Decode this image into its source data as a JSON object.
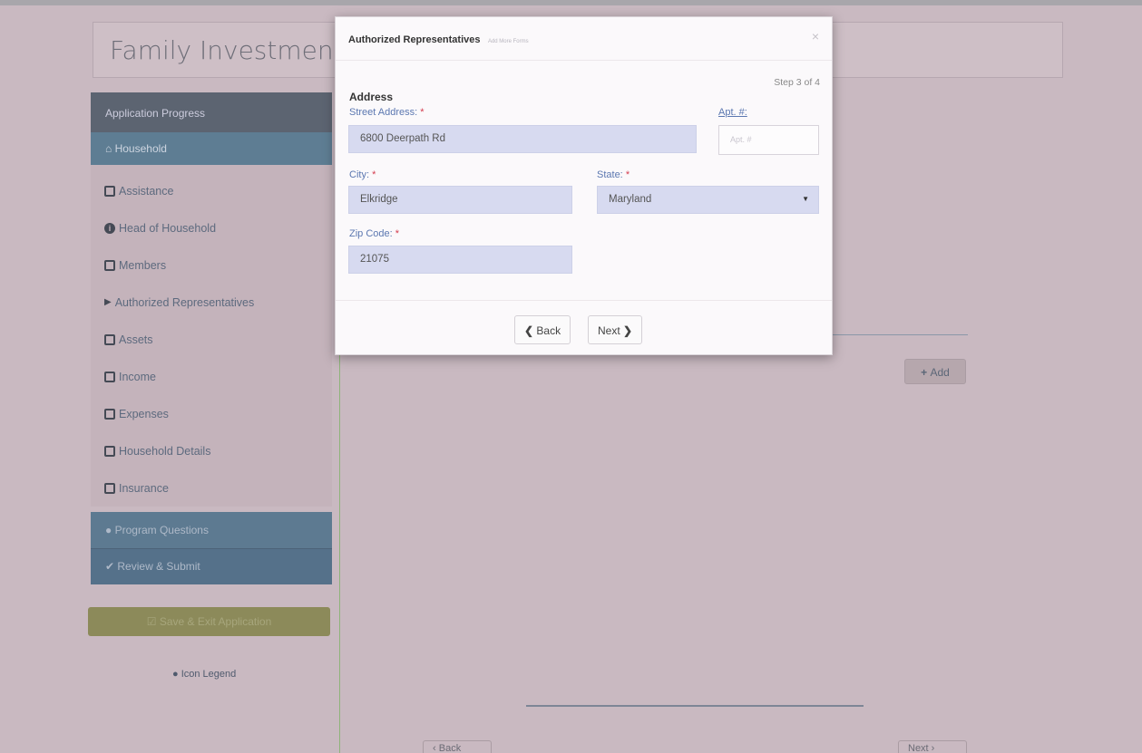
{
  "page": {
    "title": "Family Investment"
  },
  "sidebar": {
    "header": "Application Progress",
    "household": "Household",
    "items": [
      {
        "label": "Assistance",
        "icon": "checked-box-icon"
      },
      {
        "label": "Head of Household",
        "icon": "info-circle-icon"
      },
      {
        "label": "Members",
        "icon": "checked-box-icon"
      },
      {
        "label": "Authorized Representatives",
        "icon": "play-icon"
      },
      {
        "label": "Assets",
        "icon": "empty-box-icon"
      },
      {
        "label": "Income",
        "icon": "empty-box-icon"
      },
      {
        "label": "Expenses",
        "icon": "empty-box-icon"
      },
      {
        "label": "Household Details",
        "icon": "empty-box-icon"
      },
      {
        "label": "Insurance",
        "icon": "empty-box-icon"
      }
    ],
    "program_questions": "Program Questions",
    "review_submit": "Review & Submit",
    "save_exit": "Save & Exit Application",
    "icon_legend": "Icon Legend"
  },
  "content": {
    "add_label": "Add",
    "back_label": "Back",
    "next_label": "Next"
  },
  "modal": {
    "title": "Authorized Representatives",
    "subtitle": "Add More Forms",
    "close": "×",
    "step": "Step 3 of 4",
    "section": "Address",
    "street_label": "Street Address:",
    "street_value": "6800 Deerpath Rd",
    "apt_label": "Apt. #:",
    "apt_placeholder": "Apt. #",
    "city_label": "City:",
    "city_value": "Elkridge",
    "state_label": "State:",
    "state_value": "Maryland",
    "zip_label": "Zip Code:",
    "zip_value": "21075",
    "required_mark": "*",
    "back_label": "Back",
    "next_label": "Next"
  },
  "colors": {
    "overlay": "#c9b9c1",
    "sidebar_active": "#5e7d93",
    "field_fill": "#d7daf0",
    "required": "#d43c4e",
    "label": "#5b77b0"
  }
}
